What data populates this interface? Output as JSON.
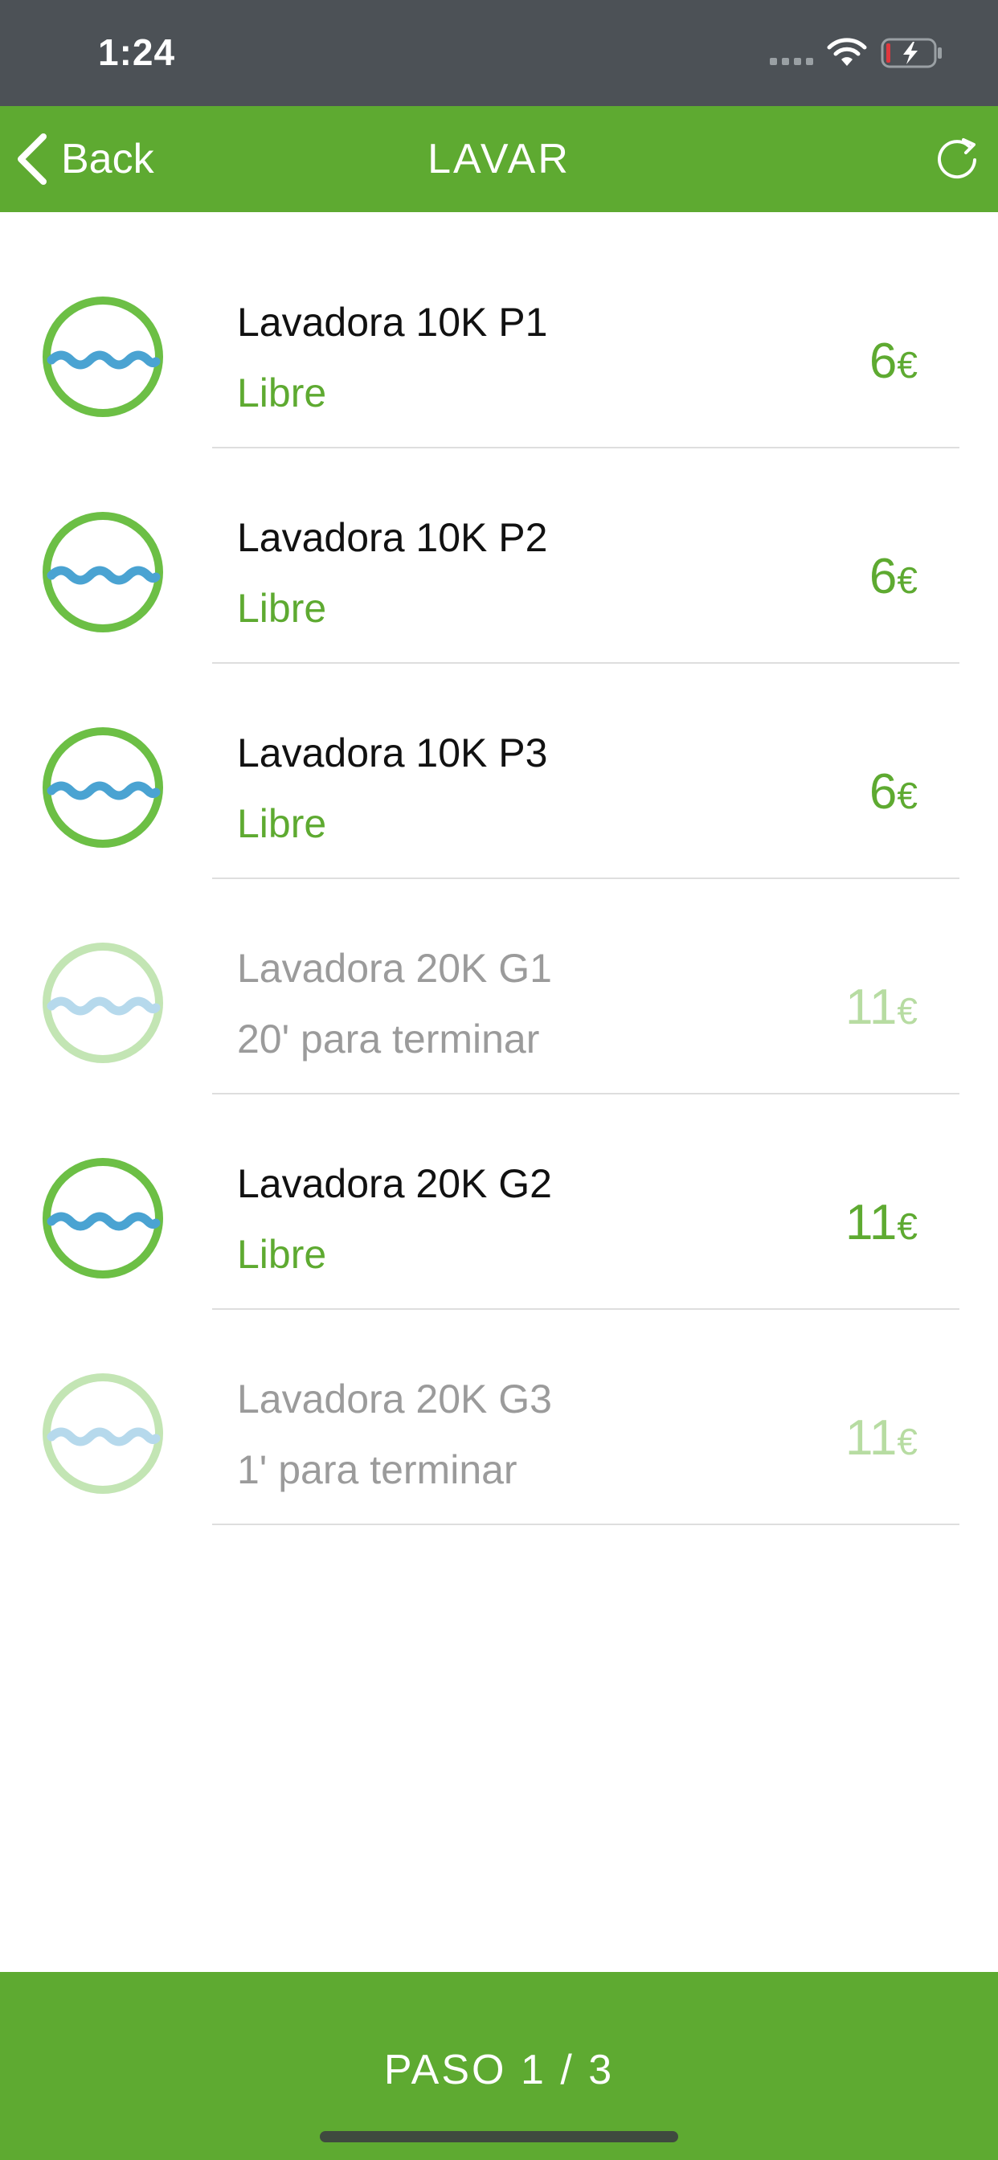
{
  "status_bar": {
    "time": "1:24"
  },
  "nav": {
    "back_label": "Back",
    "title": "LAVAR"
  },
  "colors": {
    "brand_green": "#5eaa31",
    "wave_blue": "#4aa3d2",
    "ring_green": "#6cbf45",
    "disabled_text": "#9b9b9b",
    "disabled_price": "#b7dca2"
  },
  "machines": [
    {
      "name": "Lavadora 10K P1",
      "status": "Libre",
      "price": "6",
      "currency": "€",
      "available": true
    },
    {
      "name": "Lavadora 10K P2",
      "status": "Libre",
      "price": "6",
      "currency": "€",
      "available": true
    },
    {
      "name": "Lavadora 10K P3",
      "status": "Libre",
      "price": "6",
      "currency": "€",
      "available": true
    },
    {
      "name": "Lavadora 20K G1",
      "status": "20' para terminar",
      "price": "11",
      "currency": "€",
      "available": false
    },
    {
      "name": "Lavadora 20K G2",
      "status": "Libre",
      "price": "11",
      "currency": "€",
      "available": true
    },
    {
      "name": "Lavadora 20K G3",
      "status": "1' para terminar",
      "price": "11",
      "currency": "€",
      "available": false
    }
  ],
  "footer": {
    "step_label": "PASO 1 / 3"
  }
}
